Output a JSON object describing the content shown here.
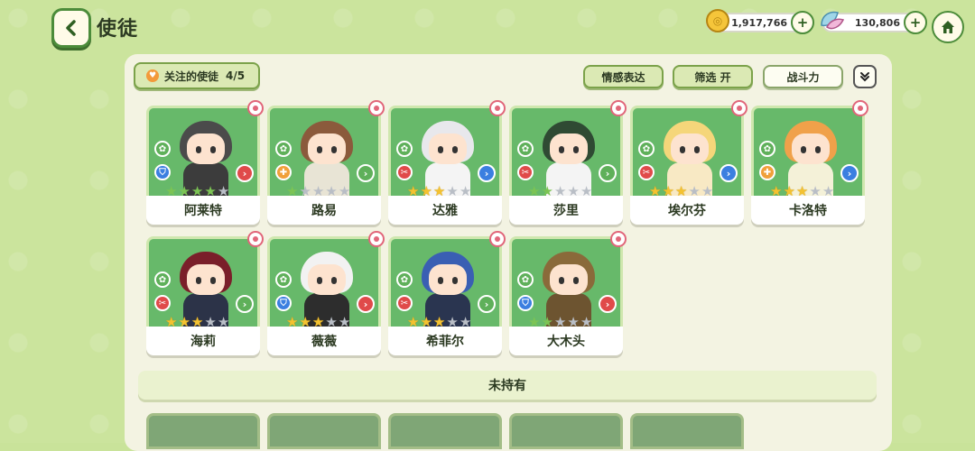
{
  "header": {
    "title": "使徒"
  },
  "currency": {
    "coins": "1,917,766",
    "gems": "130,806"
  },
  "toolbar": {
    "favorite_label": "关注的使徒",
    "favorite_count": "4/5",
    "emotion_label": "情感表达",
    "filter_label": "筛选 开",
    "sort_label": "战斗力"
  },
  "owned": [
    {
      "name": "阿莱特",
      "stars": 4,
      "star_color": "green",
      "role": "shield",
      "role_color": "#3b7fe0",
      "arrow_color": "#e04a4a",
      "hair": "#4b4b4b",
      "outfit": "#3c3c3c"
    },
    {
      "name": "路易",
      "stars": 1,
      "star_color": "green",
      "role": "heal",
      "role_color": "#f0a03a",
      "arrow_color": "#5fb05a",
      "hair": "#8b5a3c",
      "outfit": "#e8e4d5"
    },
    {
      "name": "达雅",
      "stars": 3,
      "star_color": "gold",
      "role": "attack",
      "role_color": "#e04a4a",
      "arrow_color": "#3b7fe0",
      "hair": "#e8e8ec",
      "outfit": "#f4f4f4"
    },
    {
      "name": "莎里",
      "stars": 2,
      "star_color": "green",
      "role": "attack",
      "role_color": "#e04a4a",
      "arrow_color": "#5fb05a",
      "hair": "#2f4a33",
      "outfit": "#f4f4f4"
    },
    {
      "name": "埃尔芬",
      "stars": 3,
      "star_color": "gold",
      "role": "attack",
      "role_color": "#e04a4a",
      "arrow_color": "#3b7fe0",
      "hair": "#f5d67a",
      "outfit": "#f8e9c4"
    },
    {
      "name": "卡洛特",
      "stars": 3,
      "star_color": "gold",
      "role": "heal",
      "role_color": "#f0a03a",
      "arrow_color": "#3b7fe0",
      "hair": "#f0a14a",
      "outfit": "#f4f1d8"
    },
    {
      "name": "海莉",
      "stars": 3,
      "star_color": "gold",
      "role": "attack",
      "role_color": "#e04a4a",
      "arrow_color": "#5fb05a",
      "hair": "#7a1f2a",
      "outfit": "#2c3348"
    },
    {
      "name": "薇薇",
      "stars": 3,
      "star_color": "gold",
      "role": "shield",
      "role_color": "#3b7fe0",
      "arrow_color": "#e04a4a",
      "hair": "#f2f2f2",
      "outfit": "#2d2d2d"
    },
    {
      "name": "希菲尔",
      "stars": 3,
      "star_color": "gold",
      "role": "attack",
      "role_color": "#e04a4a",
      "arrow_color": "#5fb05a",
      "hair": "#3a5fb3",
      "outfit": "#2a3550"
    },
    {
      "name": "大木头",
      "stars": 2,
      "star_color": "green",
      "role": "shield",
      "role_color": "#3b7fe0",
      "arrow_color": "#e04a4a",
      "hair": "#8a6a3a",
      "outfit": "#6d5430"
    }
  ],
  "unowned_label": "未持有",
  "icons": {
    "back": "chevron-left-icon",
    "home": "home-icon",
    "coin": "coin-icon",
    "gem": "leaf-gem-icon",
    "favorite": "heart-icon",
    "collapse": "double-chevron-down-icon"
  }
}
